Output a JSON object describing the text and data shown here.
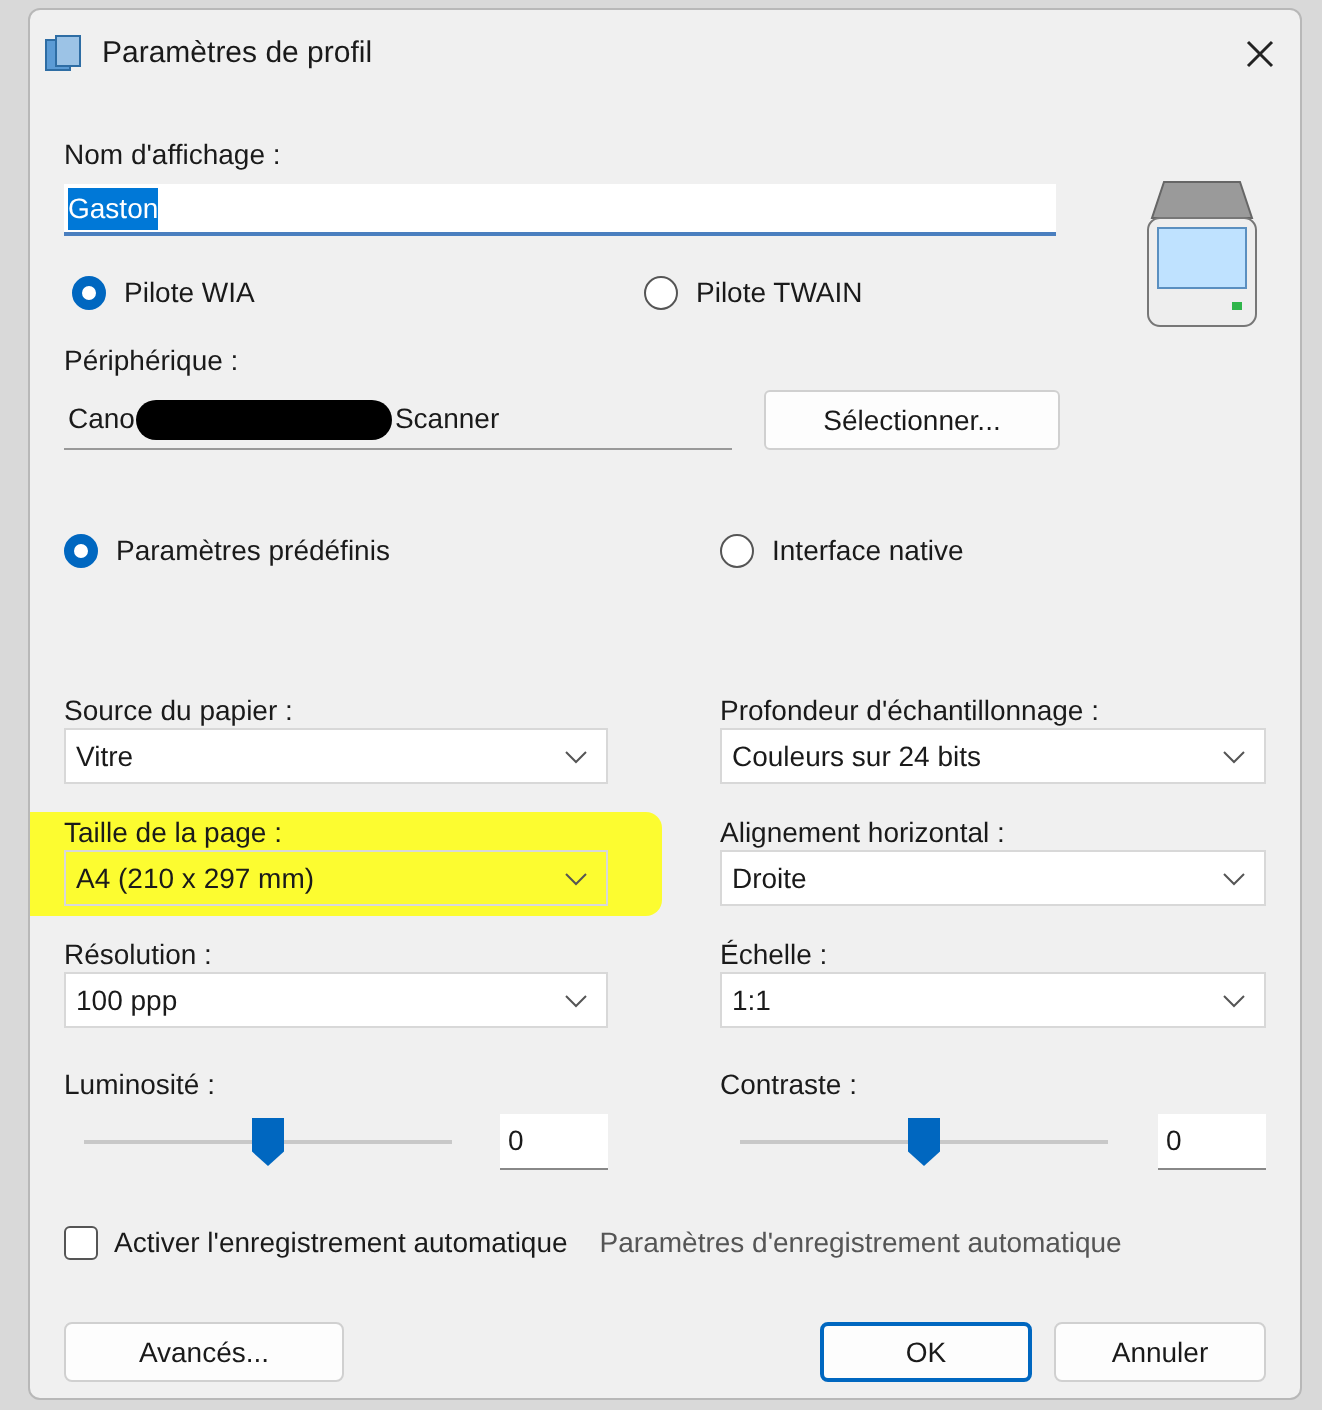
{
  "window": {
    "title": "Paramètres de profil"
  },
  "display_name": {
    "label": "Nom d'affichage :",
    "value": "Gaston",
    "text_selected": true
  },
  "drivers": [
    {
      "label": "Pilote WIA",
      "selected": true
    },
    {
      "label": "Pilote TWAIN",
      "selected": false
    }
  ],
  "device": {
    "label": "Périphérique :",
    "value_start": "Cano",
    "value_end": "Scanner",
    "redacted": true,
    "button": "Sélectionner..."
  },
  "modes": [
    {
      "label": "Paramètres prédéfinis",
      "selected": true
    },
    {
      "label": "Interface native",
      "selected": false
    }
  ],
  "selects": [
    {
      "label": "Source du papier :",
      "value": "Vitre",
      "highlighted": false
    },
    {
      "label": "Profondeur d'échantillonnage :",
      "value": "Couleurs sur 24 bits",
      "highlighted": false
    },
    {
      "label": "Taille de la page :",
      "value": "A4 (210 x 297 mm)",
      "highlighted": true
    },
    {
      "label": "Alignement horizontal :",
      "value": "Droite",
      "highlighted": false
    },
    {
      "label": "Résolution :",
      "value": "100 ppp",
      "highlighted": false
    },
    {
      "label": "Échelle :",
      "value": "1:1",
      "highlighted": false
    }
  ],
  "sliders": [
    {
      "label": "Luminosité :",
      "level": 0.5,
      "value": "0"
    },
    {
      "label": "Contraste :",
      "level": 0.5,
      "value": "0"
    }
  ],
  "autosave": {
    "label": "Activer l'enregistrement automatique",
    "checked": false,
    "link": "Paramètres d'enregistrement automatique"
  },
  "buttons": [
    {
      "label": "Avancés...",
      "default": false
    },
    {
      "label": "OK",
      "default": true
    },
    {
      "label": "Annuler",
      "default": false
    }
  ]
}
